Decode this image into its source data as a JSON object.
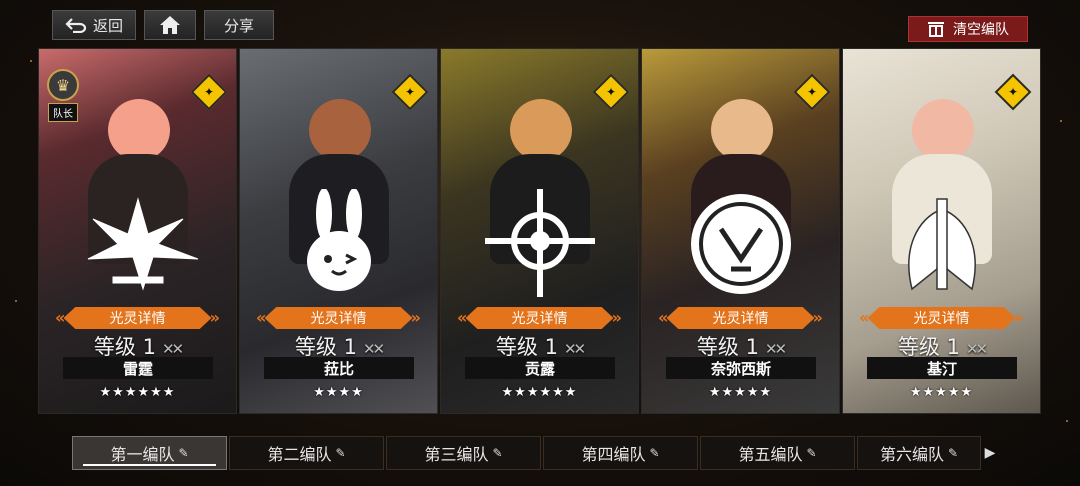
{
  "topbar": {
    "back_label": "返回",
    "share_label": "分享",
    "clear_label": "清空编队"
  },
  "cards": [
    {
      "name": "雷霆",
      "level": "等级 1",
      "stars": "★★★★★★",
      "detail_label": "光灵详情",
      "leader": true,
      "leader_tag": "队长",
      "accent": "#c96b6b"
    },
    {
      "name": "菈比",
      "level": "等级 1",
      "stars": "★★★★",
      "detail_label": "光灵详情",
      "leader": false,
      "accent": "#6a6d72"
    },
    {
      "name": "贡露",
      "level": "等级 1",
      "stars": "★★★★★★",
      "detail_label": "光灵详情",
      "leader": false,
      "accent": "#8a7a2a"
    },
    {
      "name": "奈弥西斯",
      "level": "等级 1",
      "stars": "★★★★★",
      "detail_label": "光灵详情",
      "leader": false,
      "accent": "#b99a3a"
    },
    {
      "name": "基汀",
      "level": "等级 1",
      "stars": "★★★★★",
      "detail_label": "光灵详情",
      "leader": false,
      "accent": "#e9e3d6"
    }
  ],
  "tabs": [
    {
      "label": "第一编队",
      "active": true
    },
    {
      "label": "第二编队",
      "active": false
    },
    {
      "label": "第三编队",
      "active": false
    },
    {
      "label": "第四编队",
      "active": false
    },
    {
      "label": "第五编队",
      "active": false
    },
    {
      "label": "第六编队",
      "active": false
    }
  ],
  "colors": {
    "detail_orange": "#e3741c",
    "clear_red": "#7b1a1a",
    "element_yellow": "#f4c400"
  },
  "icons": [
    "back-arrow-icon",
    "home-icon",
    "trash-icon",
    "element-badge-icon",
    "crown-icon",
    "pencil-icon",
    "chevron-right-icon"
  ]
}
